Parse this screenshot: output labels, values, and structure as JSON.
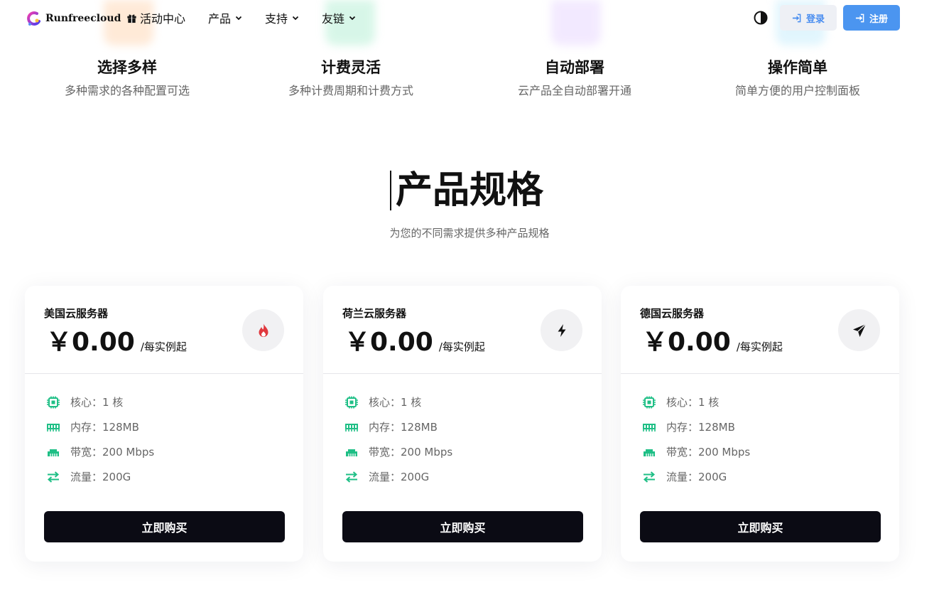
{
  "header": {
    "brand": "Runfreecloud",
    "nav": [
      {
        "label": "活动中心",
        "icon": "gift-icon",
        "dropdown": false
      },
      {
        "label": "产品",
        "dropdown": true
      },
      {
        "label": "支持",
        "dropdown": true
      },
      {
        "label": "友链",
        "dropdown": true
      }
    ],
    "login_label": "登录",
    "register_label": "注册"
  },
  "features": [
    {
      "title": "选择多样",
      "desc": "多种需求的各种配置可选"
    },
    {
      "title": "计费灵活",
      "desc": "多种计费周期和计费方式"
    },
    {
      "title": "自动部署",
      "desc": "云产品全自动部署开通"
    },
    {
      "title": "操作简单",
      "desc": "简单方便的用户控制面板"
    }
  ],
  "section": {
    "title": "产品规格",
    "subtitle": "为您的不同需求提供多种产品规格"
  },
  "cards": [
    {
      "name": "美国云服务器",
      "price": "￥0.00",
      "unit": "/每实例起",
      "badge_icon": "fire-icon",
      "specs": [
        "核心：1 核",
        "内存：128MB",
        "带宽：200 Mbps",
        "流量：200G"
      ],
      "buy_label": "立即购买"
    },
    {
      "name": "荷兰云服务器",
      "price": "￥0.00",
      "unit": "/每实例起",
      "badge_icon": "lightning-icon",
      "specs": [
        "核心：1 核",
        "内存：128MB",
        "带宽：200 Mbps",
        "流量：200G"
      ],
      "buy_label": "立即购买"
    },
    {
      "name": "德国云服务器",
      "price": "￥0.00",
      "unit": "/每实例起",
      "badge_icon": "paper-plane-icon",
      "specs": [
        "核心：1 核",
        "内存：128MB",
        "带宽：200 Mbps",
        "流量：200G"
      ],
      "buy_label": "立即购买"
    }
  ],
  "colors": {
    "accent": "#4b95f0",
    "spec_icon": "#1fbf86",
    "fire": "#e0383e",
    "buy_button": "#0b0b14"
  }
}
